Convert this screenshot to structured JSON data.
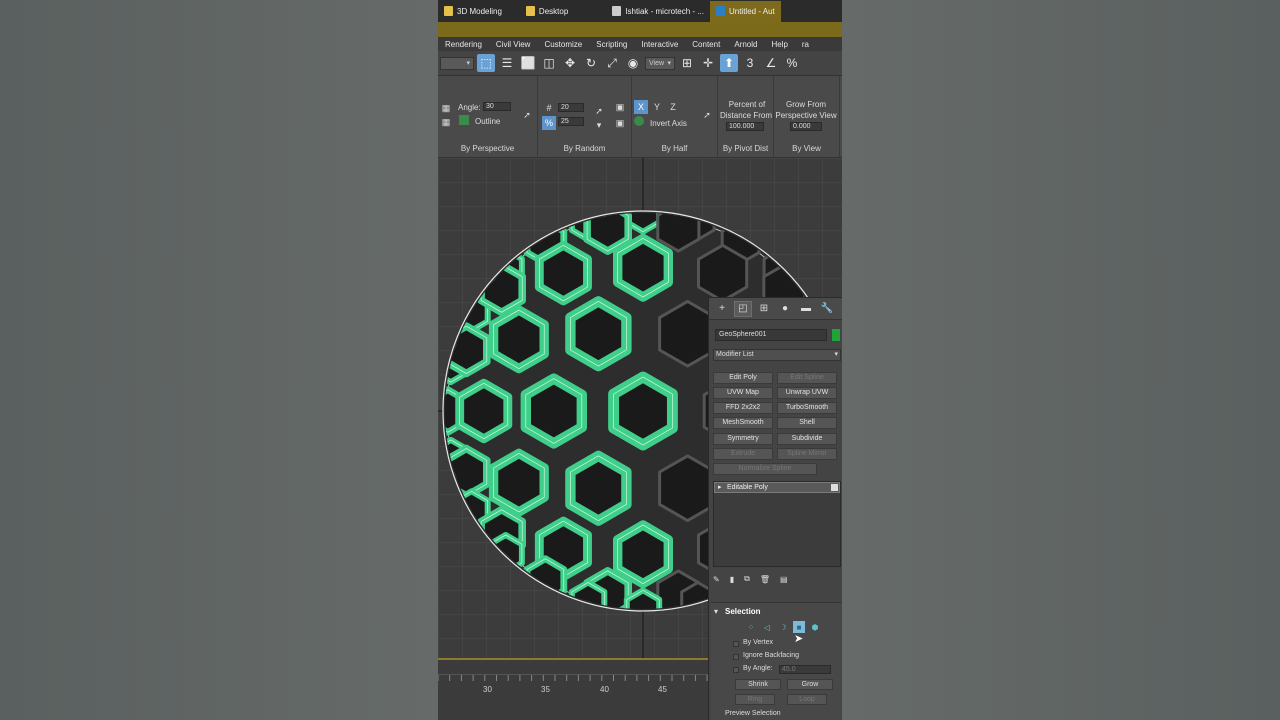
{
  "taskbar": {
    "tabs": [
      {
        "label": "3D Modeling",
        "active": false
      },
      {
        "label": "Desktop",
        "active": false
      },
      {
        "label": "Ishtiak - microtech - ...",
        "active": false
      },
      {
        "label": "Untitled - Aut",
        "active": true
      }
    ]
  },
  "menu": {
    "items": [
      "Rendering",
      "Civil View",
      "Customize",
      "Scripting",
      "Interactive",
      "Content",
      "Arnold",
      "Help",
      "ra"
    ]
  },
  "toolbar": {
    "view_dropdown": "View",
    "snap_label": "3"
  },
  "ribbon": {
    "groups": [
      {
        "label": "By Perspective"
      },
      {
        "label": "By Random"
      },
      {
        "label": "By Half"
      },
      {
        "label": "By Pivot Dist"
      },
      {
        "label": "By View"
      }
    ],
    "angle_label": "Angle:",
    "angle_value": "30",
    "outline_label": "Outline",
    "random_value_1": "20",
    "random_value_2": "25",
    "axis_x": "X",
    "axis_y": "Y",
    "axis_z": "Z",
    "invert_axis_label": "Invert Axis",
    "percent_label_1": "Percent of",
    "percent_label_2": "Distance From",
    "percent_value": "100.000",
    "grow_label_1": "Grow From",
    "grow_label_2": "Perspective View",
    "grow_value": "0.000"
  },
  "timeline": {
    "ticks": [
      "30",
      "35",
      "40",
      "45"
    ]
  },
  "command_panel": {
    "object_name": "GeoSphere001",
    "object_color": "#22a33a",
    "modifier_list": "Modifier List",
    "modifier_buttons": [
      {
        "label": "Edit Poly",
        "enabled": true
      },
      {
        "label": "Edit Spline",
        "enabled": false
      },
      {
        "label": "UVW Map",
        "enabled": true
      },
      {
        "label": "Unwrap UVW",
        "enabled": true
      },
      {
        "label": "FFD 2x2x2",
        "enabled": true
      },
      {
        "label": "TurboSmooth",
        "enabled": true
      },
      {
        "label": "MeshSmooth",
        "enabled": true
      },
      {
        "label": "Shell",
        "enabled": true
      },
      {
        "label": "Symmetry",
        "enabled": true
      },
      {
        "label": "Subdivide",
        "enabled": true
      },
      {
        "label": "Extrude",
        "enabled": false
      },
      {
        "label": "Spline Mirror",
        "enabled": false
      },
      {
        "label": "Normalize Spline",
        "enabled": false
      }
    ],
    "stack_item": "Editable Poly",
    "selection": {
      "title": "Selection",
      "by_vertex": "By Vertex",
      "ignore_backfacing": "Ignore Backfacing",
      "by_angle": "By Angle:",
      "angle_value": "45.0",
      "shrink": "Shrink",
      "grow": "Grow",
      "ring": "Ring",
      "loop": "Loop",
      "preview_selection": "Preview Selection"
    }
  },
  "colors": {
    "accent": "#6aa2d6",
    "selected_poly": "#3fcf8a",
    "timeline_bar": "#8d7a2a"
  }
}
